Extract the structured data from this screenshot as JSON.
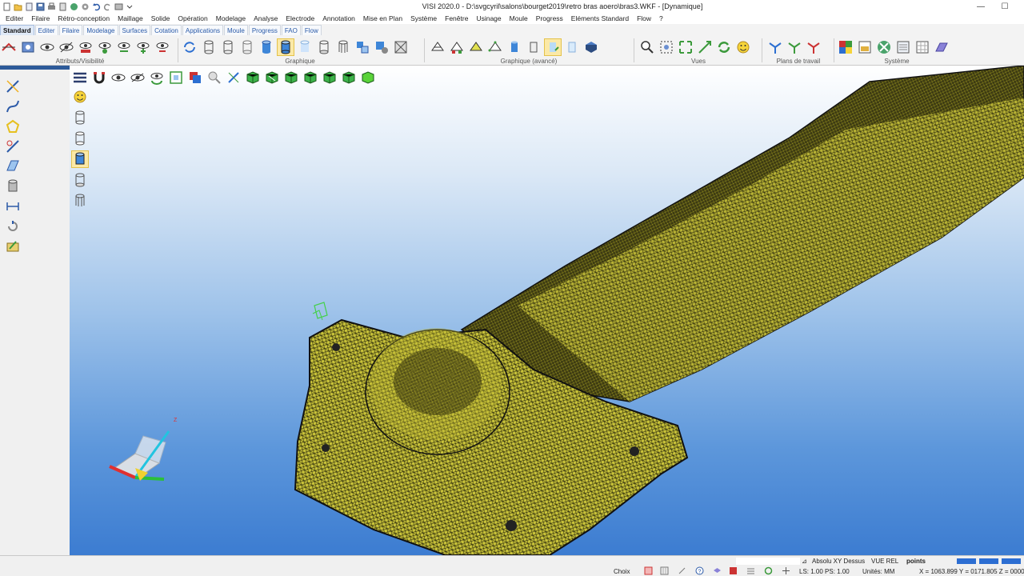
{
  "window": {
    "title": "VISI 2020.0 - D:\\svgcyril\\salons\\bourget2019\\retro bras aoero\\bras3.WKF - [Dynamique]",
    "minimize": "—",
    "maximize": "☐"
  },
  "menu": [
    "Editer",
    "Filaire",
    "Rétro-conception",
    "Maillage",
    "Solide",
    "Opération",
    "Modelage",
    "Analyse",
    "Electrode",
    "Annotation",
    "Mise en Plan",
    "Système",
    "Fenêtre",
    "Usinage",
    "Moule",
    "Progress",
    "Eléments Standard",
    "Flow",
    "?"
  ],
  "ribbon_tabs": [
    "Standard",
    "Editer",
    "Filaire",
    "Modelage",
    "Surfaces",
    "Cotation",
    "Applications",
    "Moule",
    "Progress",
    "FAO",
    "Flow"
  ],
  "ribbon_groups": {
    "attributs": "Attributs/Visibilité",
    "graphique": "Graphique",
    "graphique_avance": "Graphique (avancé)",
    "vues": "Vues",
    "plans": "Plans de travail",
    "systeme": "Système"
  },
  "axis": {
    "z_label": "Z"
  },
  "status": {
    "choix": "Choix",
    "absolu": "Absolu XY Dessus",
    "vue_rel": "VUE REL",
    "points": "points",
    "ls_ps": "LS: 1.00 PS: 1.00",
    "unites": "Unités: MM",
    "coords": "X = 1063.899 Y = 0171.805 Z = 0000"
  },
  "colors": {
    "viewport_top": "#ffffff",
    "viewport_bottom": "#3c7cd1",
    "mesh": "#d6d235",
    "accent": "#2d5a99"
  }
}
